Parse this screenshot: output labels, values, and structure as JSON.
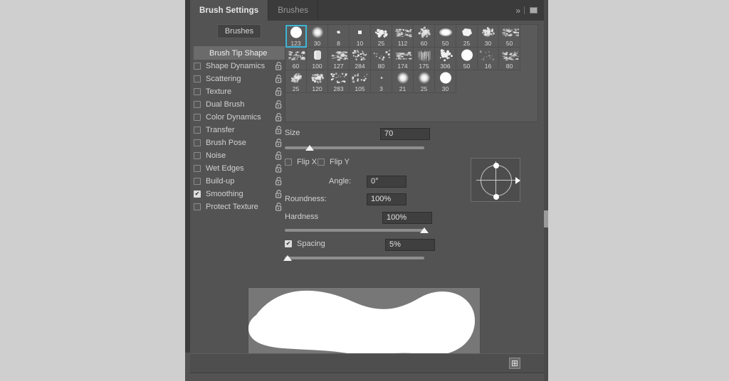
{
  "app": {
    "panel_title": "Brush Settings",
    "background_color": "#cfcfcf",
    "panel_color": "#535353",
    "accent_color": "#3fb6d8"
  },
  "tabs": [
    {
      "label": "Brush Settings",
      "active": true
    },
    {
      "label": "Brushes",
      "active": false
    }
  ],
  "header_icons": {
    "collapse": "chevron-double-right-icon",
    "menu": "panel-menu-icon"
  },
  "sidebar": {
    "brushes_button": "Brushes",
    "tip_shape": "Brush Tip Shape",
    "items": [
      {
        "label": "Shape Dynamics",
        "checked": false,
        "locked": true
      },
      {
        "label": "Scattering",
        "checked": false,
        "locked": true
      },
      {
        "label": "Texture",
        "checked": false,
        "locked": true
      },
      {
        "label": "Dual Brush",
        "checked": false,
        "locked": true
      },
      {
        "label": "Color Dynamics",
        "checked": false,
        "locked": true
      },
      {
        "label": "Transfer",
        "checked": false,
        "locked": true
      },
      {
        "label": "Brush Pose",
        "checked": false,
        "locked": true
      },
      {
        "label": "Noise",
        "checked": false,
        "locked": true
      },
      {
        "label": "Wet Edges",
        "checked": false,
        "locked": true
      },
      {
        "label": "Build-up",
        "checked": false,
        "locked": true
      },
      {
        "label": "Smoothing",
        "checked": true,
        "locked": true
      },
      {
        "label": "Protect Texture",
        "checked": false,
        "locked": true
      }
    ]
  },
  "brush_grid": {
    "selected_index": 0,
    "presets": [
      {
        "size": "123",
        "kind": "hard-round"
      },
      {
        "size": "30",
        "kind": "soft-round"
      },
      {
        "size": "8",
        "kind": "chalk-small"
      },
      {
        "size": "10",
        "kind": "square-small"
      },
      {
        "size": "25",
        "kind": "splatter"
      },
      {
        "size": "112",
        "kind": "texture-rough"
      },
      {
        "size": "60",
        "kind": "sponge"
      },
      {
        "size": "50",
        "kind": "soft-oval"
      },
      {
        "size": "25",
        "kind": "chalk-blob"
      },
      {
        "size": "30",
        "kind": "grain-round"
      },
      {
        "size": "50",
        "kind": "scatter-dry"
      },
      {
        "size": "60",
        "kind": "scatter-dry"
      },
      {
        "size": "100",
        "kind": "flat-bristle"
      },
      {
        "size": "127",
        "kind": "dry-brush"
      },
      {
        "size": "284",
        "kind": "spatter-fine"
      },
      {
        "size": "80",
        "kind": "spatter-sparse"
      },
      {
        "size": "174",
        "kind": "dry-streak"
      },
      {
        "size": "175",
        "kind": "hair-streak"
      },
      {
        "size": "306",
        "kind": "splatter-big"
      },
      {
        "size": "50",
        "kind": "hard-round"
      },
      {
        "size": "16",
        "kind": "faint-splatter"
      },
      {
        "size": "80",
        "kind": "dry-brush"
      },
      {
        "size": "25",
        "kind": "grain-cluster"
      },
      {
        "size": "120",
        "kind": "sponge-ring"
      },
      {
        "size": "283",
        "kind": "spatter-fine"
      },
      {
        "size": "105",
        "kind": "spatter-sparse"
      },
      {
        "size": "3",
        "kind": "dot-tiny"
      },
      {
        "size": "21",
        "kind": "soft-round"
      },
      {
        "size": "25",
        "kind": "soft-round"
      },
      {
        "size": "30",
        "kind": "hard-round"
      }
    ]
  },
  "controls": {
    "size": {
      "label": "Size",
      "value": "70",
      "slider_pct": 18
    },
    "flip_x": {
      "label": "Flip X",
      "checked": false
    },
    "flip_y": {
      "label": "Flip Y",
      "checked": false
    },
    "angle": {
      "label": "Angle:",
      "value": "0°"
    },
    "roundness": {
      "label": "Roundness:",
      "value": "100%"
    },
    "hardness": {
      "label": "Hardness",
      "value": "100%",
      "slider_pct": 100
    },
    "spacing": {
      "label": "Spacing",
      "value": "5%",
      "checked": true,
      "slider_pct": 2
    }
  },
  "preview": {
    "name": "brush-stroke-preview",
    "stroke_color": "#ffffff",
    "canvas_color": "#777777"
  },
  "footer": {
    "new_brush_icon": "new-brush-preset-icon",
    "new_brush_glyph": "⊞"
  }
}
